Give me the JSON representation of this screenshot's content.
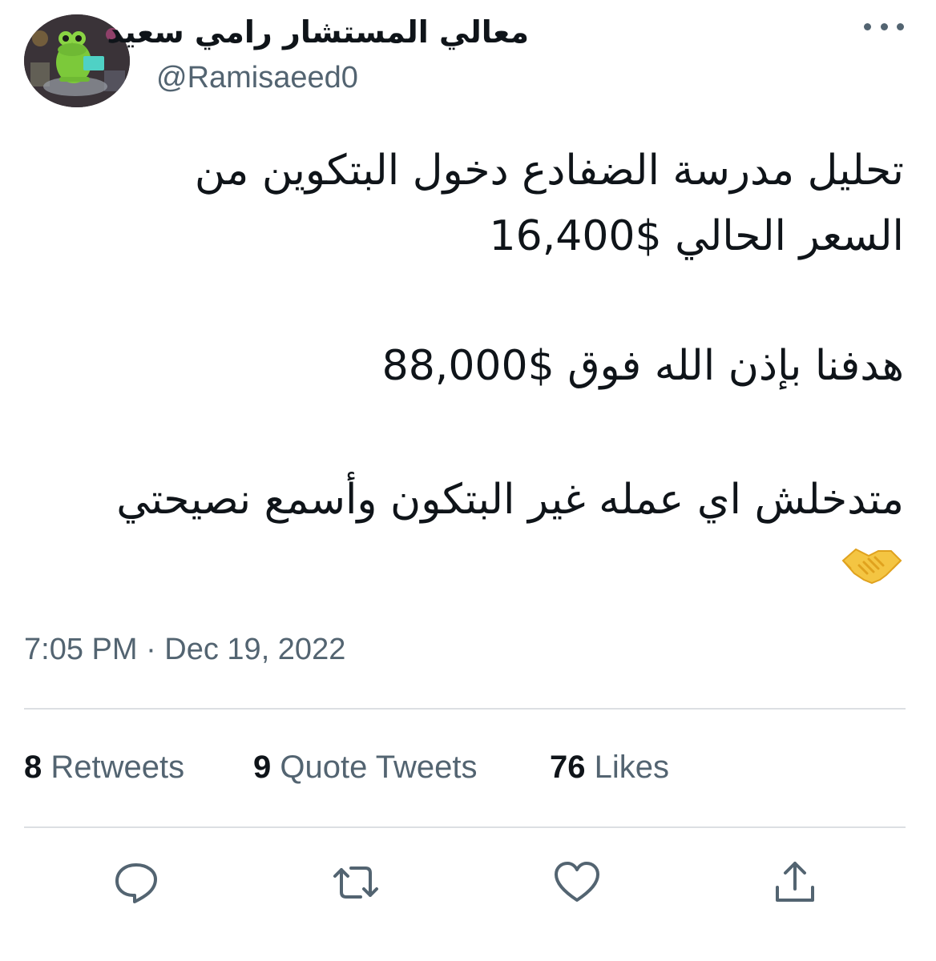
{
  "author": {
    "display_name": "معالي المستشار رامي سعيد",
    "handle": "@Ramisaeed0",
    "avatar_icon": "frog-avatar"
  },
  "tweet": {
    "lines": [
      "تحليل مدرسة الضفادع دخول البتكوين من",
      "السعر الحالي $16,400",
      "هدفنا بإذن الله فوق $88,000",
      "متدخلش اي عمله غير البتكون وأسمع نصيحتي"
    ],
    "emoji": "🤝",
    "timestamp": "7:05 PM · Dec 19, 2022"
  },
  "stats": {
    "retweets": {
      "count": "8",
      "label": "Retweets"
    },
    "quotes": {
      "count": "9",
      "label": "Quote Tweets"
    },
    "likes": {
      "count": "76",
      "label": "Likes"
    }
  },
  "actions": {
    "reply_icon": "reply-icon",
    "retweet_icon": "retweet-icon",
    "like_icon": "heart-icon",
    "share_icon": "share-icon"
  },
  "colors": {
    "text": "#0f1419",
    "secondary": "#536471",
    "divider": "#dcdfe3",
    "icon": "#536471",
    "emoji": "#f4c542"
  }
}
